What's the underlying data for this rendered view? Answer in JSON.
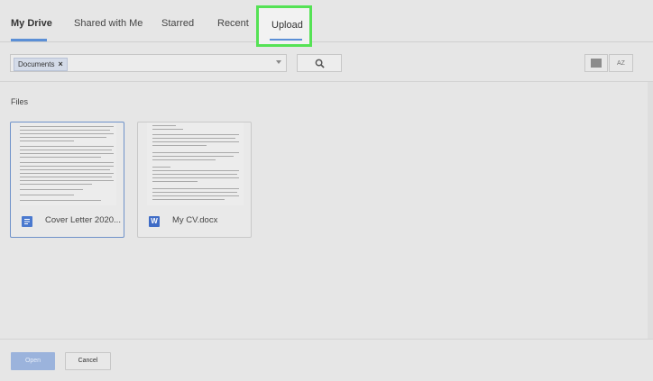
{
  "tabs": [
    {
      "label": "My Drive",
      "active": true
    },
    {
      "label": "Shared with Me",
      "active": false
    },
    {
      "label": "Starred",
      "active": false
    },
    {
      "label": "Recent",
      "active": false
    },
    {
      "label": "Upload",
      "active": false,
      "highlighted": true
    }
  ],
  "search": {
    "chip_label": "Documents",
    "chip_remove": "×",
    "button_icon": "search-icon"
  },
  "view_controls": {
    "list_icon": "list-view-icon",
    "sort_label": "AZ"
  },
  "files_section": {
    "heading": "Files",
    "files": [
      {
        "name": "Cover Letter 2020...",
        "type_icon": "google-doc-icon",
        "selected": true
      },
      {
        "name": "My CV.docx",
        "type_icon": "word-doc-icon",
        "type_letter": "W",
        "selected": false
      }
    ]
  },
  "footer": {
    "open_label": "Open",
    "cancel_label": "Cancel"
  },
  "colors": {
    "accent_blue": "#5b8fd6",
    "highlight_green": "#55e255",
    "open_button": "#9bb3dc"
  }
}
